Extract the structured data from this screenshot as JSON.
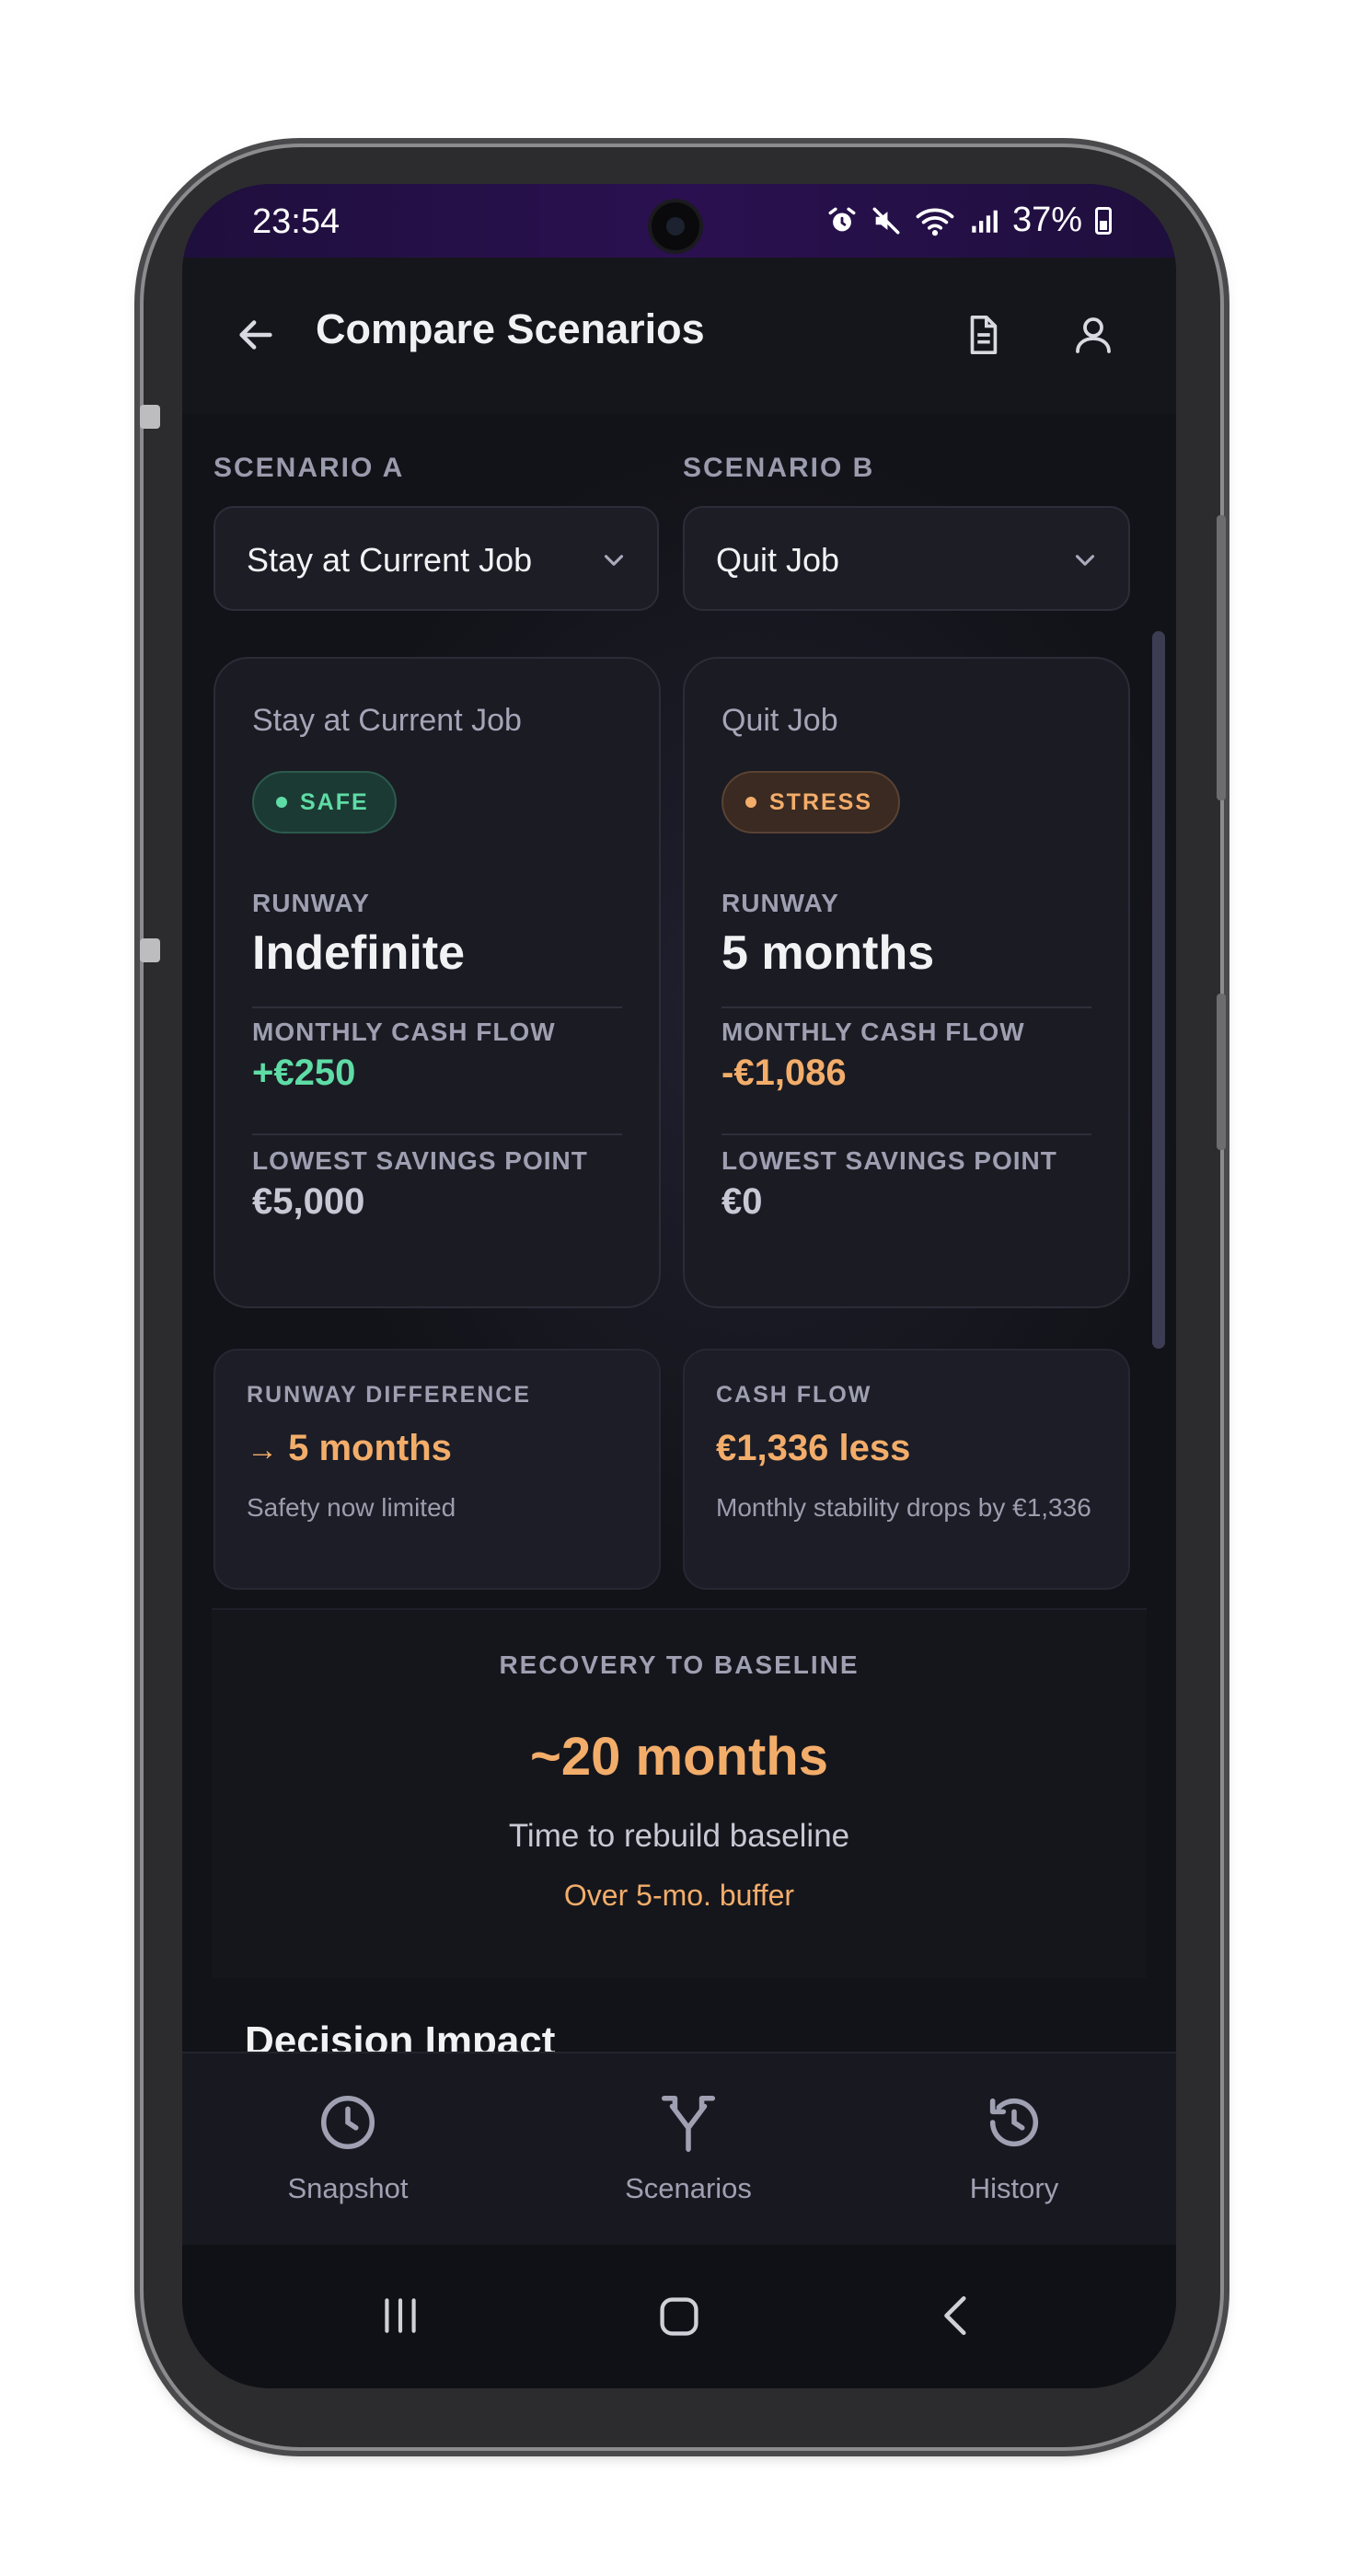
{
  "status_bar": {
    "time": "23:54",
    "battery": "37%"
  },
  "header": {
    "title": "Compare Scenarios"
  },
  "selectors": {
    "a": {
      "label": "SCENARIO A",
      "value": "Stay at Current Job"
    },
    "b": {
      "label": "SCENARIO B",
      "value": "Quit Job"
    }
  },
  "scenario_a": {
    "name": "Stay at Current Job",
    "status": "SAFE",
    "runway_label": "RUNWAY",
    "runway_value": "Indefinite",
    "cashflow_label": "MONTHLY CASH FLOW",
    "cashflow_value": "+€250",
    "lowest_label": "LOWEST SAVINGS POINT",
    "lowest_value": "€5,000"
  },
  "scenario_b": {
    "name": "Quit Job",
    "status": "STRESS",
    "runway_label": "RUNWAY",
    "runway_value": "5 months",
    "cashflow_label": "MONTHLY CASH FLOW",
    "cashflow_value": "-€1,086",
    "lowest_label": "LOWEST SAVINGS POINT",
    "lowest_value": "€0"
  },
  "runway_diff": {
    "label": "RUNWAY DIFFERENCE",
    "arrow": "→",
    "value": "5 months",
    "sub": "Safety now limited"
  },
  "cash_flow_diff": {
    "label": "CASH FLOW",
    "value": "€1,336 less",
    "sub": "Monthly stability drops by €1,336"
  },
  "recovery": {
    "label": "RECOVERY TO BASELINE",
    "value": "~20 months",
    "sub": "Time to rebuild baseline",
    "note": "Over 5-mo. buffer"
  },
  "section": {
    "decision_impact": "Decision Impact"
  },
  "nav": {
    "snapshot": "Snapshot",
    "scenarios": "Scenarios",
    "history": "History"
  },
  "colors": {
    "safe": "#5fdca6",
    "stress": "#f3ad6a",
    "background": "#121318",
    "status_bar": "#2a1050"
  },
  "icons": [
    "back-arrow-icon",
    "document-icon",
    "profile-icon",
    "chevron-down-icon",
    "clock-icon",
    "fork-icon",
    "history-icon",
    "alarm-icon",
    "mute-icon",
    "wifi-icon",
    "signal-icon",
    "battery-icon"
  ]
}
